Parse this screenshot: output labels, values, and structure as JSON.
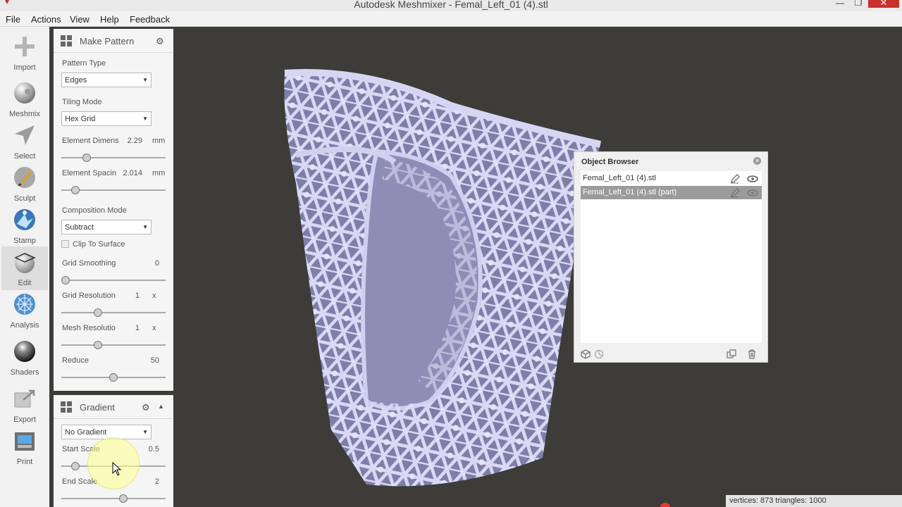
{
  "window": {
    "title": "Autodesk Meshmixer - Femal_Left_01 (4).stl",
    "minimize": "—",
    "maximize": "❐",
    "close": "✕"
  },
  "menu": [
    "File",
    "Actions",
    "View",
    "Help",
    "Feedback"
  ],
  "tools": [
    {
      "label": "Import",
      "icon": "plus-icon"
    },
    {
      "label": "Meshmix",
      "icon": "meshmix-icon"
    },
    {
      "label": "Select",
      "icon": "select-arrow-icon"
    },
    {
      "label": "Sculpt",
      "icon": "brush-icon"
    },
    {
      "label": "Stamp",
      "icon": "stamp-icon"
    },
    {
      "label": "Edit",
      "icon": "edit-icon",
      "active": true
    },
    {
      "label": "Analysis",
      "icon": "analysis-icon"
    },
    {
      "label": "Shaders",
      "icon": "sphere-icon"
    },
    {
      "label": "Export",
      "icon": "export-icon"
    },
    {
      "label": "Print",
      "icon": "printer-icon"
    }
  ],
  "make_pattern": {
    "title": "Make Pattern",
    "pattern_type_label": "Pattern Type",
    "pattern_type": "Edges",
    "tiling_mode_label": "Tiling Mode",
    "tiling_mode": "Hex Grid",
    "element_dimens_label": "Element Dimens",
    "element_dimens_value": "2.29",
    "element_dimens_unit": "mm",
    "element_dimens_level": 0.22,
    "element_spacing_label": "Element Spacin",
    "element_spacing_value": "2.014",
    "element_spacing_unit": "mm",
    "element_spacing_level": 0.1,
    "composition_mode_label": "Composition Mode",
    "composition_mode": "Subtract",
    "clip_to_surface_label": "Clip To Surface",
    "clip_to_surface_checked": false,
    "grid_smoothing_label": "Grid Smoothing",
    "grid_smoothing_value": "0",
    "grid_smoothing_level": 0.0,
    "grid_resolution_label": "Grid Resolution",
    "grid_resolution_value": "1",
    "grid_resolution_unit": "x",
    "grid_resolution_level": 0.34,
    "mesh_resolution_label": "Mesh Resolutio",
    "mesh_resolution_value": "1",
    "mesh_resolution_unit": "x",
    "mesh_resolution_level": 0.34,
    "reduce_label": "Reduce",
    "reduce_value": "50",
    "reduce_level": 0.5
  },
  "gradient": {
    "title": "Gradient",
    "mode": "No Gradient",
    "start_scale_label": "Start Scale",
    "start_scale_value": "0.5",
    "start_scale_level": 0.1,
    "end_scale_label": "End Scale",
    "end_scale_value": "2",
    "end_scale_level": 0.6
  },
  "object_browser": {
    "title": "Object Browser",
    "items": [
      {
        "name": "Femal_Left_01 (4).stl",
        "selected": false
      },
      {
        "name": "Femal_Left_01 (4).stl (part)",
        "selected": true
      }
    ]
  },
  "status": {
    "text": "vertices: 873 triangles: 1000"
  },
  "colors": {
    "mesh": "#b8b8e6",
    "viewport_bg": "#3d3c39",
    "accent_close": "#c7302b"
  }
}
